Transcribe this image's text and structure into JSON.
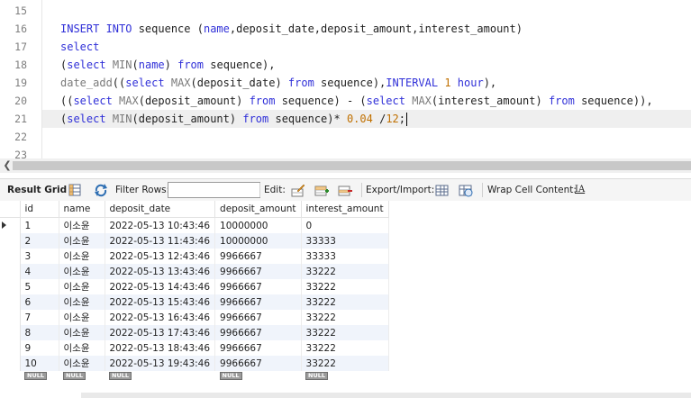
{
  "editor": {
    "lines": [
      {
        "no": "15",
        "tokens": []
      },
      {
        "no": "16",
        "tokens": [
          {
            "t": "INSERT INTO",
            "c": "kw"
          },
          {
            "t": " sequence (",
            "c": "id"
          },
          {
            "t": "name",
            "c": "kw"
          },
          {
            "t": ",deposit_date,deposit_amount,interest_amount)",
            "c": "id"
          }
        ]
      },
      {
        "no": "17",
        "tokens": [
          {
            "t": "select",
            "c": "kw"
          }
        ]
      },
      {
        "no": "18",
        "tokens": [
          {
            "t": "(",
            "c": "id"
          },
          {
            "t": "select",
            "c": "kw"
          },
          {
            "t": " ",
            "c": "id"
          },
          {
            "t": "MIN",
            "c": "fn"
          },
          {
            "t": "(",
            "c": "id"
          },
          {
            "t": "name",
            "c": "kw"
          },
          {
            "t": ") ",
            "c": "id"
          },
          {
            "t": "from",
            "c": "kw"
          },
          {
            "t": " sequence),",
            "c": "id"
          }
        ]
      },
      {
        "no": "19",
        "tokens": [
          {
            "t": "date_add",
            "c": "fn"
          },
          {
            "t": "((",
            "c": "id"
          },
          {
            "t": "select",
            "c": "kw"
          },
          {
            "t": " ",
            "c": "id"
          },
          {
            "t": "MAX",
            "c": "fn"
          },
          {
            "t": "(deposit_date) ",
            "c": "id"
          },
          {
            "t": "from",
            "c": "kw"
          },
          {
            "t": " sequence),",
            "c": "id"
          },
          {
            "t": "INTERVAL",
            "c": "kw"
          },
          {
            "t": " ",
            "c": "id"
          },
          {
            "t": "1",
            "c": "num"
          },
          {
            "t": " ",
            "c": "id"
          },
          {
            "t": "hour",
            "c": "kw"
          },
          {
            "t": "),",
            "c": "id"
          }
        ]
      },
      {
        "no": "20",
        "tokens": [
          {
            "t": "((",
            "c": "id"
          },
          {
            "t": "select",
            "c": "kw"
          },
          {
            "t": " ",
            "c": "id"
          },
          {
            "t": "MAX",
            "c": "fn"
          },
          {
            "t": "(deposit_amount) ",
            "c": "id"
          },
          {
            "t": "from",
            "c": "kw"
          },
          {
            "t": " sequence) - (",
            "c": "id"
          },
          {
            "t": "select",
            "c": "kw"
          },
          {
            "t": " ",
            "c": "id"
          },
          {
            "t": "MAX",
            "c": "fn"
          },
          {
            "t": "(interest_amount) ",
            "c": "id"
          },
          {
            "t": "from",
            "c": "kw"
          },
          {
            "t": " sequence)),",
            "c": "id"
          }
        ]
      },
      {
        "no": "21",
        "current": true,
        "tokens": [
          {
            "t": "(",
            "c": "id"
          },
          {
            "t": "select",
            "c": "kw"
          },
          {
            "t": " ",
            "c": "id"
          },
          {
            "t": "MIN",
            "c": "fn"
          },
          {
            "t": "(deposit_amount) ",
            "c": "id"
          },
          {
            "t": "from",
            "c": "kw"
          },
          {
            "t": " sequence)* ",
            "c": "id"
          },
          {
            "t": "0.04",
            "c": "num"
          },
          {
            "t": " /",
            "c": "id"
          },
          {
            "t": "12",
            "c": "num"
          },
          {
            "t": ";",
            "c": "id"
          }
        ]
      },
      {
        "no": "22",
        "tokens": []
      },
      {
        "no": "23",
        "tokens": []
      }
    ],
    "scroll_left_icon": "chevron-left-icon"
  },
  "toolbar": {
    "result_grid_label": "Result Grid",
    "filter_rows_label": "Filter Rows:",
    "filter_value": "",
    "edit_label": "Edit:",
    "export_import_label": "Export/Import:",
    "wrap_label": "Wrap Cell Content:",
    "wrap_icon_text": "IA",
    "icons": [
      "grid-icon",
      "refresh-icon",
      "edit-row-icon",
      "add-row-icon",
      "delete-row-icon",
      "export-icon",
      "import-icon",
      "wrap-cell-icon"
    ]
  },
  "grid": {
    "columns": [
      "id",
      "name",
      "deposit_date",
      "deposit_amount",
      "interest_amount"
    ],
    "rows": [
      [
        "1",
        "이소윤",
        "2022-05-13 10:43:46",
        "10000000",
        "0"
      ],
      [
        "2",
        "이소윤",
        "2022-05-13 11:43:46",
        "10000000",
        "33333"
      ],
      [
        "3",
        "이소윤",
        "2022-05-13 12:43:46",
        "9966667",
        "33333"
      ],
      [
        "4",
        "이소윤",
        "2022-05-13 13:43:46",
        "9966667",
        "33222"
      ],
      [
        "5",
        "이소윤",
        "2022-05-13 14:43:46",
        "9966667",
        "33222"
      ],
      [
        "6",
        "이소윤",
        "2022-05-13 15:43:46",
        "9966667",
        "33222"
      ],
      [
        "7",
        "이소윤",
        "2022-05-13 16:43:46",
        "9966667",
        "33222"
      ],
      [
        "8",
        "이소윤",
        "2022-05-13 17:43:46",
        "9966667",
        "33222"
      ],
      [
        "9",
        "이소윤",
        "2022-05-13 18:43:46",
        "9966667",
        "33222"
      ],
      [
        "10",
        "이소윤",
        "2022-05-13 19:43:46",
        "9966667",
        "33222"
      ]
    ],
    "null_label": "NULL"
  }
}
